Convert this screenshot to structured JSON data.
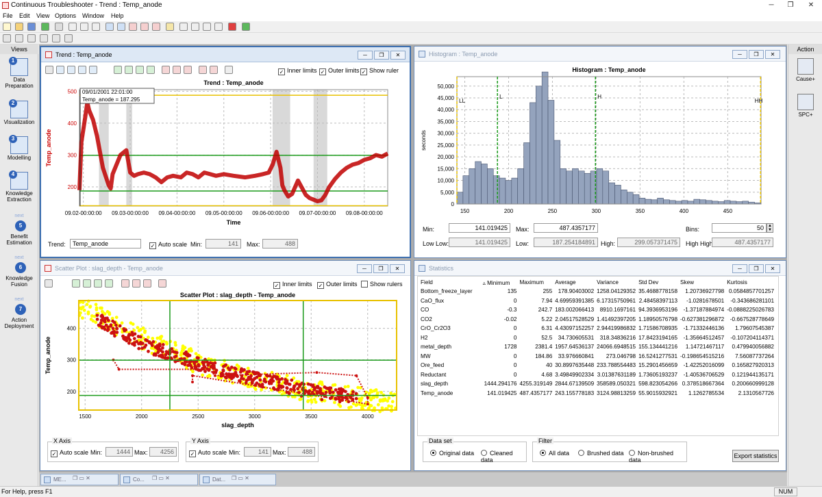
{
  "window": {
    "title": "Continuous Troubleshooter - Trend : Temp_anode",
    "min": "─",
    "max": "❐",
    "close": "✕"
  },
  "menu": [
    "File",
    "Edit",
    "View",
    "Options",
    "Window",
    "Help"
  ],
  "views": {
    "header": "Views",
    "items": [
      {
        "num": "",
        "label": "Data\nPreparation",
        "icon": "data-preparation-icon"
      },
      {
        "num": "2",
        "label": "Visualization",
        "icon": "visualization-icon"
      },
      {
        "num": "3",
        "label": "Modelling",
        "icon": "modelling-icon"
      },
      {
        "num": "4",
        "label": "Knowledge\nExtraction",
        "icon": "knowledge-extraction-icon"
      },
      {
        "num": "5",
        "label": "Benefit\nEstimation",
        "icon": "benefit-estimation-icon",
        "next": "next"
      },
      {
        "num": "6",
        "label": "Knowledge\nFusion",
        "icon": "knowledge-fusion-icon",
        "next": "next"
      },
      {
        "num": "7",
        "label": "Action\nDeployment",
        "icon": "action-deployment-icon",
        "next": "next"
      }
    ]
  },
  "action": {
    "header": "Action",
    "items": [
      {
        "label": "Cause+",
        "icon": "cause-icon"
      },
      {
        "label": "SPC+",
        "icon": "spc-icon"
      }
    ]
  },
  "trend": {
    "window_title": "Trend : Temp_anode",
    "inner_limits": "Inner limits",
    "outer_limits": "Outer limits",
    "show_ruler": "Show ruler",
    "cursor_time": "09/01/2001 22:01:00",
    "cursor_value": "Temp_anode = 187.295",
    "trend_label": "Trend:",
    "trend_value": "Temp_anode",
    "auto_scale": "Auto scale",
    "min_label": "Min:",
    "min_value": "141",
    "max_label": "Max:",
    "max_value": "488"
  },
  "histogram": {
    "window_title": "Histogram : Temp_anode",
    "min_label": "Min:",
    "min_value": "141.019425",
    "max_label": "Max:",
    "max_value": "487.4357177",
    "bins_label": "Bins:",
    "bins_value": "50",
    "lowlow_label": "Low Low:",
    "lowlow_value": "141.019425",
    "low_label": "Low:",
    "low_value": "187.254184891",
    "high_label": "High:",
    "high_value": "299.057371475",
    "highhigh_label": "High High:",
    "highhigh_value": "487.4357177"
  },
  "scatter": {
    "window_title": "Scatter Plot : slag_depth - Temp_anode",
    "inner_limits": "Inner limits",
    "outer_limits": "Outer limits",
    "show_rulers": "Show rulers",
    "xaxis_group": "X Axis",
    "yaxis_group": "Y Axis",
    "auto_scale": "Auto scale",
    "min_label": "Min:",
    "max_label": "Max:",
    "x_min": "1444",
    "x_max": "4256",
    "y_min": "141",
    "y_max": "488"
  },
  "statistics": {
    "window_title": "Statistics",
    "columns": [
      "Field",
      "Minimum",
      "Maximum",
      "Average",
      "Variance",
      "Std Dev",
      "Skew",
      "Kurtosis"
    ],
    "rows": [
      [
        "Bottom_freeze_layer",
        "135",
        "255",
        "178.90403002",
        "1258.04129352",
        "35.4688778158",
        "1.20736927798",
        "0.0584857701257"
      ],
      [
        "CaO_flux",
        "0",
        "7.94",
        "4.69959391385",
        "6.17315750961",
        "2.48458397113",
        "-1.0281678501",
        "-0.343686281101"
      ],
      [
        "CO",
        "-0.3",
        "242.7",
        "183.002066413",
        "8910.1697161",
        "94.3936953196",
        "-1.37187884974",
        "-0.0888225026783"
      ],
      [
        "CO2",
        "-0.02",
        "5.22",
        "2.04517528529",
        "1.41492397205",
        "1.18950576798",
        "-0.627381296872",
        "-0.667528778649"
      ],
      [
        "CrO_Cr2O3",
        "0",
        "6.31",
        "4.43097152257",
        "2.94419986832",
        "1.71586708935",
        "-1.71332446136",
        "1.79607545387"
      ],
      [
        "H2",
        "0",
        "52.5",
        "34.730605531",
        "318.34836216",
        "17.8423194165",
        "-1.35664512457",
        "-0.107204114371"
      ],
      [
        "metal_depth",
        "1728",
        "2381.4",
        "1957.64536137",
        "24066.6948515",
        "155.134441216",
        "1.14721467117",
        "0.479940056882"
      ],
      [
        "MW",
        "0",
        "184.86",
        "33.976660841",
        "273.046798",
        "16.5241277531",
        "-0.198654515216",
        "7.56087737264"
      ],
      [
        "Ore_feed",
        "0",
        "40",
        "30.8997635448",
        "233.788554483",
        "15.2901456659",
        "-1.42252016099",
        "0.165827920313"
      ],
      [
        "Reductant",
        "0",
        "4.68",
        "3.49849902334",
        "3.01387631189",
        "1.73605193237",
        "-1.40536706529",
        "0.121944135171"
      ],
      [
        "slag_depth",
        "1444.294176",
        "4255.319149",
        "2844.67139509",
        "358589.050321",
        "598.823054266",
        "0.378518667364",
        "0.200660999128"
      ],
      [
        "Temp_anode",
        "141.019425",
        "487.4357177",
        "243.155778183",
        "3124.98813259",
        "55.9015932921",
        "1.1262785534",
        "2.1310567726"
      ]
    ],
    "dataset_group": "Data set",
    "original": "Original data",
    "cleaned": "Cleaned data",
    "filter_group": "Filter",
    "all": "All data",
    "brushed": "Brushed data",
    "nonbrushed": "Non-brushed data",
    "export": "Export statistics"
  },
  "taskbar": [
    {
      "label": "ME..."
    },
    {
      "label": "Co..."
    },
    {
      "label": "Dat..."
    }
  ],
  "status": {
    "left": "For Help, press F1",
    "right": "NUM"
  },
  "chart_data": [
    {
      "type": "line",
      "title": "Trend : Temp_anode",
      "xlabel": "Time",
      "ylabel": "Temp_anode",
      "x_ticks": [
        "09.02-00:00:00",
        "09.03-00:00:00",
        "09.04-00:00:00",
        "09.05-00:00:00",
        "09.06-00:00:00",
        "09.07-00:00:00",
        "09.08-00:00:00"
      ],
      "y_ticks": [
        "200",
        "300",
        "400",
        "500"
      ],
      "ylim": [
        140,
        505
      ],
      "xlim": [
        "09.01-22:00:00",
        "09.08-12:00:00"
      ],
      "limits": {
        "low_low": 141.019425,
        "low": 187.254184891,
        "high": 299.057371475,
        "high_high": 487.4357177
      },
      "series": [
        {
          "x": [
            "09.01-22:00",
            "09.01-23:00",
            "09.02-01:00",
            "09.02-02:00",
            "09.02-03:00",
            "09.02-05:00",
            "09.02-07:00",
            "09.02-10:00",
            "09.02-13:00",
            "09.02-14:00",
            "09.02-15:00",
            "09.02-19:00",
            "09.02-22:00",
            "09.03-00:00",
            "09.03-02:00",
            "09.03-04:00",
            "09.03-07:00",
            "09.03-10:00",
            "09.03-13:00",
            "09.03-16:00",
            "09.03-19:00",
            "09.03-22:00",
            "09.04-02:00",
            "09.04-05:00",
            "09.04-08:00",
            "09.04-11:00",
            "09.04-14:00",
            "09.04-17:00",
            "09.04-20:00",
            "09.05-00:00",
            "09.05-05:00",
            "09.05-11:00",
            "09.05-16:00",
            "09.05-20:00",
            "09.05-23:00",
            "09.06-01:00",
            "09.06-03:00",
            "09.06-05:00",
            "09.06-06:00",
            "09.06-07:00",
            "09.06-08:00",
            "09.06-09:00",
            "09.06-11:00",
            "09.06-14:00",
            "09.06-18:00",
            "09.06-20:00",
            "09.06-22:00",
            "09.07-00:00",
            "09.07-02:00",
            "09.07-04:00",
            "09.07-06:00",
            "09.07-09:00",
            "09.07-12:00",
            "09.07-15:00",
            "09.07-18:00",
            "09.07-21:00",
            "09.08-00:00",
            "09.08-03:00",
            "09.08-06:00",
            "09.08-09:00",
            "09.08-12:00"
          ],
          "y": [
            190,
            340,
            420,
            465,
            440,
            410,
            360,
            260,
            205,
            195,
            240,
            300,
            315,
            245,
            235,
            240,
            245,
            240,
            230,
            215,
            230,
            235,
            230,
            245,
            240,
            230,
            245,
            240,
            235,
            240,
            235,
            230,
            235,
            240,
            245,
            270,
            310,
            260,
            205,
            190,
            180,
            170,
            178,
            220,
            175,
            165,
            160,
            155,
            158,
            175,
            200,
            225,
            245,
            260,
            270,
            275,
            285,
            290,
            300,
            295,
            305
          ]
        }
      ]
    },
    {
      "type": "bar",
      "title": "Histogram : Temp_anode",
      "xlabel": "",
      "ylabel": "seconds",
      "x_ticks": [
        "150",
        "200",
        "250",
        "300",
        "350",
        "400",
        "450"
      ],
      "y_ticks": [
        "0",
        "5,000",
        "10,000",
        "15,000",
        "20,000",
        "25,000",
        "30,000",
        "35,000",
        "40,000",
        "45,000",
        "50,000"
      ],
      "xlim": [
        141,
        488
      ],
      "ylim": [
        0,
        54000
      ],
      "bin_width": 6.93,
      "bin_start": 141.02,
      "values": [
        5000,
        12000,
        15000,
        18000,
        17000,
        15000,
        12000,
        11000,
        10000,
        11000,
        15000,
        26000,
        43000,
        50000,
        56000,
        44000,
        27000,
        15000,
        14000,
        15000,
        14000,
        13000,
        14000,
        15000,
        14000,
        9000,
        8000,
        6000,
        5000,
        4000,
        2500,
        2000,
        1800,
        2500,
        1800,
        1500,
        1200,
        1500,
        1200,
        2000,
        1800,
        1500,
        1200,
        1000,
        1500,
        1200,
        1000,
        1200,
        800,
        500
      ],
      "markers": [
        {
          "label": "LL",
          "value": 141.019425
        },
        {
          "label": "L",
          "value": 187.254184891
        },
        {
          "label": "H",
          "value": 299.057371475
        },
        {
          "label": "HH",
          "value": 487.4357177
        }
      ]
    },
    {
      "type": "scatter",
      "title": "Scatter Plot : slag_depth - Temp_anode",
      "xlabel": "slag_depth",
      "ylabel": "Temp_anode",
      "x_ticks": [
        "1500",
        "2000",
        "2500",
        "3000",
        "3500",
        "4000"
      ],
      "y_ticks": [
        "200",
        "300",
        "400"
      ],
      "xlim": [
        1444,
        4256
      ],
      "ylim": [
        141,
        488
      ],
      "series": [
        {
          "name": "Non-brushed data",
          "color": "#ffff00",
          "band": {
            "x": [
              1444,
              2000,
              2500,
              3000,
              3500,
              4000,
              4256
            ],
            "y": [
              470,
              370,
              290,
              240,
              200,
              175,
              160
            ],
            "spread": 35
          }
        },
        {
          "name": "Brushed data",
          "color": "#cc1111",
          "band": {
            "x": [
              1600,
              2000,
              2500,
              3000,
              3500,
              3900
            ],
            "y": [
              430,
              350,
              290,
              240,
              200,
              180
            ],
            "spread": 22
          }
        }
      ],
      "limits": {
        "x_low": 2250,
        "x_high": 3430,
        "y_low": 187.25,
        "y_high": 299.06
      }
    }
  ]
}
